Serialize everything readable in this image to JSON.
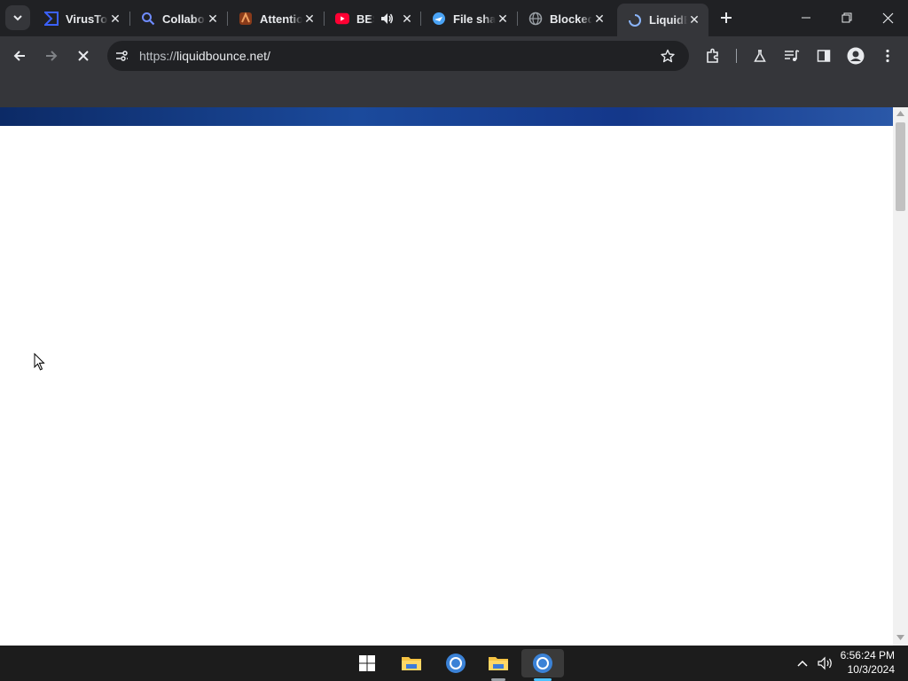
{
  "browser": {
    "tabs": [
      {
        "title": "VirusTotal",
        "icon": "virustotal-icon",
        "active": false
      },
      {
        "title": "Collaborator",
        "icon": "search-icon",
        "active": false
      },
      {
        "title": "Attention",
        "icon": "attention-icon",
        "active": false
      },
      {
        "title": "BEST",
        "icon": "youtube-icon",
        "active": false,
        "audio": true
      },
      {
        "title": "File sharing",
        "icon": "file-share-icon",
        "active": false
      },
      {
        "title": "Blocked",
        "icon": "globe-icon",
        "active": false
      },
      {
        "title": "LiquidBounce",
        "icon": "loading-icon",
        "active": true
      }
    ],
    "url_prefix": "https://",
    "url_host": "liquidbounce.net/"
  },
  "taskbar": {
    "time": "6:56:24 PM",
    "date": "10/3/2024"
  }
}
